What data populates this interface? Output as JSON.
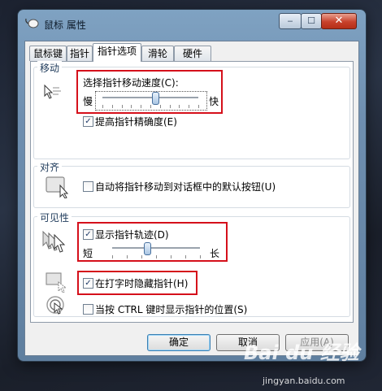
{
  "window": {
    "title": "鼠标 属性",
    "min": "‒",
    "max": "☐",
    "close": "✕"
  },
  "tabs": [
    {
      "label": "鼠标键",
      "active": false
    },
    {
      "label": "指针",
      "active": false
    },
    {
      "label": "指针选项",
      "active": true
    },
    {
      "label": "滑轮",
      "active": false
    },
    {
      "label": "硬件",
      "active": false
    }
  ],
  "motion": {
    "title": "移动",
    "speed_label": "选择指针移动速度(C):",
    "slow": "慢",
    "fast": "快",
    "speed_value": 0.55,
    "precision_label": "提高指针精确度(E)",
    "precision_checked": true
  },
  "snap": {
    "title": "对齐",
    "label": "自动将指针移动到对话框中的默认按钮(U)",
    "checked": false
  },
  "visibility": {
    "title": "可见性",
    "trails_label": "显示指针轨迹(D)",
    "trails_checked": true,
    "short": "短",
    "long": "长",
    "trails_value": 0.4,
    "hide_label": "在打字时隐藏指针(H)",
    "hide_checked": true,
    "ctrl_label": "当按 CTRL 键时显示指针的位置(S)",
    "ctrl_checked": false
  },
  "buttons": {
    "ok": "确定",
    "cancel": "取消",
    "apply": "应用(A)"
  },
  "watermark": {
    "text": "Bai du 经验",
    "url": "jingyan.baidu.com"
  }
}
